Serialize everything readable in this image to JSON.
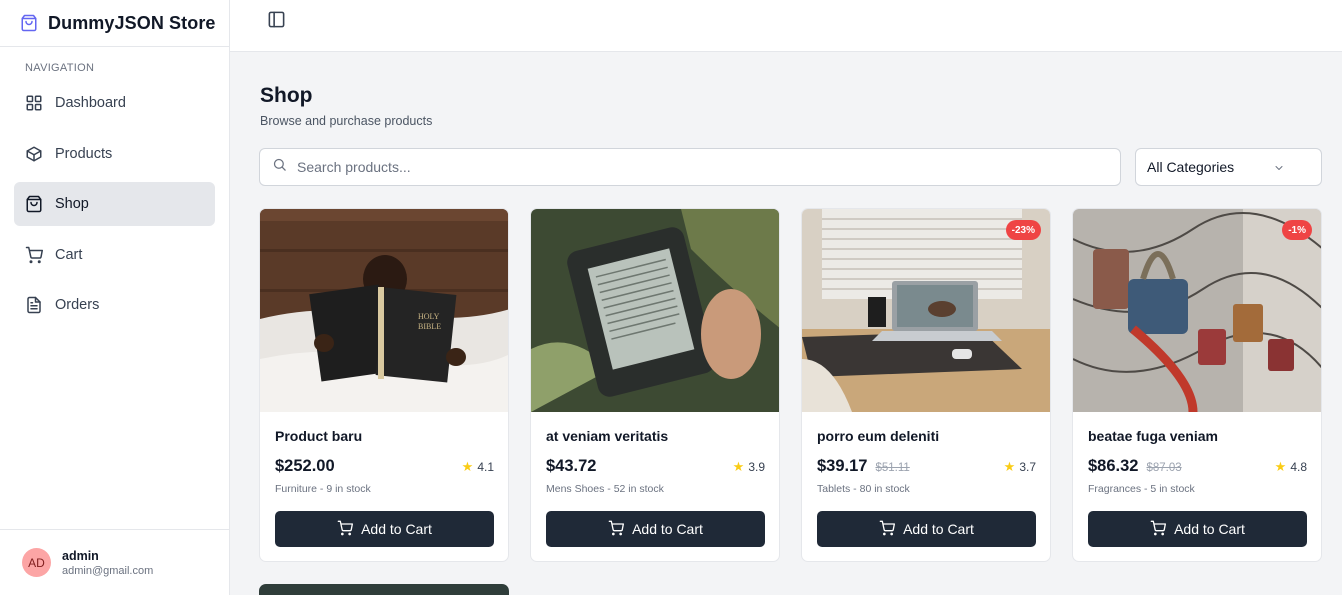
{
  "app": {
    "title": "DummyJSON Store"
  },
  "nav": {
    "heading": "NAVIGATION",
    "items": [
      {
        "label": "Dashboard",
        "icon": "grid-icon",
        "active": false
      },
      {
        "label": "Products",
        "icon": "box-icon",
        "active": false
      },
      {
        "label": "Shop",
        "icon": "shopping-bag-icon",
        "active": true
      },
      {
        "label": "Cart",
        "icon": "cart-icon",
        "active": false
      },
      {
        "label": "Orders",
        "icon": "document-icon",
        "active": false
      }
    ]
  },
  "user": {
    "initials": "AD",
    "name": "admin",
    "email": "admin@gmail.com"
  },
  "page": {
    "title": "Shop",
    "subtitle": "Browse and purchase products"
  },
  "search": {
    "placeholder": "Search products...",
    "value": ""
  },
  "category_select": {
    "selected": "All Categories"
  },
  "products": [
    {
      "name": "Product baru",
      "price": "$252.00",
      "old_price": "",
      "discount": "",
      "rating": "4.1",
      "meta": "Furniture - 9 in stock",
      "button": "Add to Cart"
    },
    {
      "name": "at veniam veritatis",
      "price": "$43.72",
      "old_price": "",
      "discount": "",
      "rating": "3.9",
      "meta": "Mens Shoes - 52 in stock",
      "button": "Add to Cart"
    },
    {
      "name": "porro eum deleniti",
      "price": "$39.17",
      "old_price": "$51.11",
      "discount": "-23%",
      "rating": "3.7",
      "meta": "Tablets - 80 in stock",
      "button": "Add to Cart"
    },
    {
      "name": "beatae fuga veniam",
      "price": "$86.32",
      "old_price": "$87.03",
      "discount": "-1%",
      "rating": "4.8",
      "meta": "Fragrances - 5 in stock",
      "button": "Add to Cart"
    }
  ],
  "colors": {
    "accent": "#1f2937",
    "badge": "#ef4444",
    "star": "#facc15",
    "brand_icon": "#6366f1"
  }
}
